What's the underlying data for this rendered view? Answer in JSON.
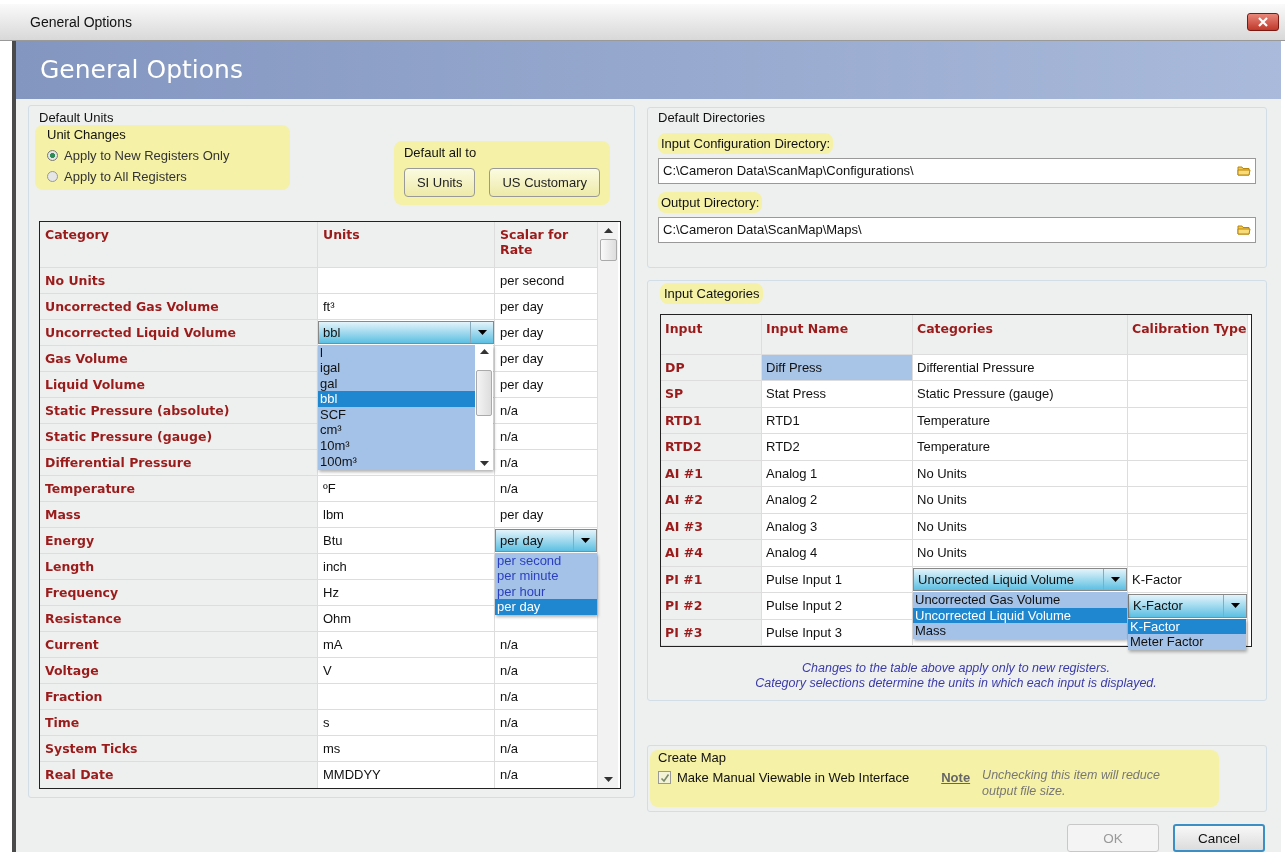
{
  "window": {
    "title": "General Options"
  },
  "header": {
    "title": "General Options"
  },
  "default_units": {
    "title": "Default Units",
    "unit_changes": {
      "title": "Unit Changes",
      "highlighted": true,
      "options": [
        {
          "label": "Apply to New Registers Only",
          "selected": true
        },
        {
          "label": "Apply to All Registers",
          "selected": false
        }
      ]
    },
    "default_all_to": {
      "title": "Default all to",
      "highlighted": true,
      "buttons": [
        "SI Units",
        "US Customary"
      ]
    },
    "table": {
      "columns": [
        "Category",
        "Units",
        "Scalar for Rate"
      ],
      "rows": [
        {
          "category": "No Units",
          "units": "",
          "scalar": "per second"
        },
        {
          "category": "Uncorrected Gas Volume",
          "units": "ft³",
          "scalar": "per day"
        },
        {
          "category": "Uncorrected Liquid Volume",
          "scalar": "per day",
          "units_dropdown": {
            "value": "bbl",
            "options": [
              {
                "label": "l",
                "selected": false
              },
              {
                "label": "igal",
                "selected": false
              },
              {
                "label": "gal",
                "selected": false
              },
              {
                "label": "bbl",
                "selected": true
              },
              {
                "label": "SCF",
                "selected": false
              },
              {
                "label": "cm³",
                "selected": false
              },
              {
                "label": "10m³",
                "selected": false
              },
              {
                "label": "100m³",
                "selected": false
              }
            ]
          }
        },
        {
          "category": "Gas Volume",
          "scalar": "per day"
        },
        {
          "category": "Liquid Volume",
          "scalar": "per day"
        },
        {
          "category": "Static Pressure (absolute)",
          "scalar": "n/a"
        },
        {
          "category": "Static Pressure (gauge)",
          "scalar": "n/a"
        },
        {
          "category": "Differential Pressure",
          "scalar": "n/a"
        },
        {
          "category": "Temperature",
          "units": "ºF",
          "scalar": "n/a"
        },
        {
          "category": "Mass",
          "units": "lbm",
          "scalar": "per day"
        },
        {
          "category": "Energy",
          "units": "Btu",
          "scalar_dropdown": {
            "value": "per day",
            "options": [
              {
                "label": "per second",
                "selected": false
              },
              {
                "label": "per minute",
                "selected": false
              },
              {
                "label": "per hour",
                "selected": false
              },
              {
                "label": "per day",
                "selected": true
              }
            ]
          }
        },
        {
          "category": "Length",
          "units": "inch"
        },
        {
          "category": "Frequency",
          "units": "Hz"
        },
        {
          "category": "Resistance",
          "units": "Ohm"
        },
        {
          "category": "Current",
          "units": "mA",
          "scalar": "n/a"
        },
        {
          "category": "Voltage",
          "units": "V",
          "scalar": "n/a"
        },
        {
          "category": "Fraction",
          "units": "",
          "scalar": "n/a"
        },
        {
          "category": "Time",
          "units": "s",
          "scalar": "n/a"
        },
        {
          "category": "System Ticks",
          "units": "ms",
          "scalar": "n/a"
        },
        {
          "category": "Real Date",
          "units": "MMDDYY",
          "scalar": "n/a"
        }
      ]
    }
  },
  "default_directories": {
    "title": "Default Directories",
    "fields": [
      {
        "label": "Input Configuration Directory:",
        "highlighted": true,
        "value": "C:\\Cameron Data\\ScanMap\\Configurations\\"
      },
      {
        "label": "Output Directory:",
        "highlighted": true,
        "value": "C:\\Cameron Data\\ScanMap\\Maps\\"
      }
    ]
  },
  "input_categories": {
    "title": "Input Categories",
    "highlighted": true,
    "columns": [
      "Input",
      "Input Name",
      "Categories",
      "Calibration Type"
    ],
    "rows": [
      {
        "input": "DP",
        "name": "Diff Press",
        "name_selected": true,
        "category": "Differential Pressure"
      },
      {
        "input": "SP",
        "name": "Stat Press",
        "name_selected": false,
        "category": "Static Pressure (gauge)"
      },
      {
        "input": "RTD1",
        "name": "RTD1",
        "name_selected": false,
        "category": "Temperature"
      },
      {
        "input": "RTD2",
        "name": "RTD2",
        "name_selected": false,
        "category": "Temperature"
      },
      {
        "input": "AI #1",
        "name": "Analog 1",
        "name_selected": false,
        "category": "No Units"
      },
      {
        "input": "AI #2",
        "name": "Analog 2",
        "name_selected": false,
        "category": "No Units"
      },
      {
        "input": "AI #3",
        "name": "Analog 3",
        "name_selected": false,
        "category": "No Units"
      },
      {
        "input": "AI #4",
        "name": "Analog 4",
        "name_selected": false,
        "category": "No Units"
      },
      {
        "input": "PI #1",
        "name": "Pulse Input 1",
        "name_selected": false,
        "calibration": "K-Factor",
        "category_dropdown": {
          "value": "Uncorrected Liquid Volume",
          "options": [
            {
              "label": "Uncorrected Gas Volume",
              "selected": false
            },
            {
              "label": "Uncorrected Liquid Volume",
              "selected": true
            },
            {
              "label": "Mass",
              "selected": false
            }
          ]
        }
      },
      {
        "input": "PI #2",
        "name": "Pulse Input 2",
        "name_selected": false,
        "calibration_dropdown": {
          "value": "K-Factor",
          "options": [
            {
              "label": "K-Factor",
              "selected": true
            },
            {
              "label": "Meter Factor",
              "selected": false
            }
          ]
        }
      },
      {
        "input": "PI #3",
        "name": "Pulse Input 3",
        "name_selected": false
      }
    ],
    "notes": [
      "Changes to the table above apply only to new registers.",
      "Category selections determine the units in which each input is displayed."
    ]
  },
  "create_map": {
    "title": "Create Map",
    "highlighted": true,
    "checkbox": {
      "label": "Make Manual Viewable in Web Interface",
      "checked": true
    },
    "note_label": "Note",
    "note_text": "Unchecking this item will reduce output file size."
  },
  "buttons": [
    {
      "label": "OK",
      "disabled": true
    },
    {
      "label": "Cancel",
      "disabled": false
    }
  ]
}
